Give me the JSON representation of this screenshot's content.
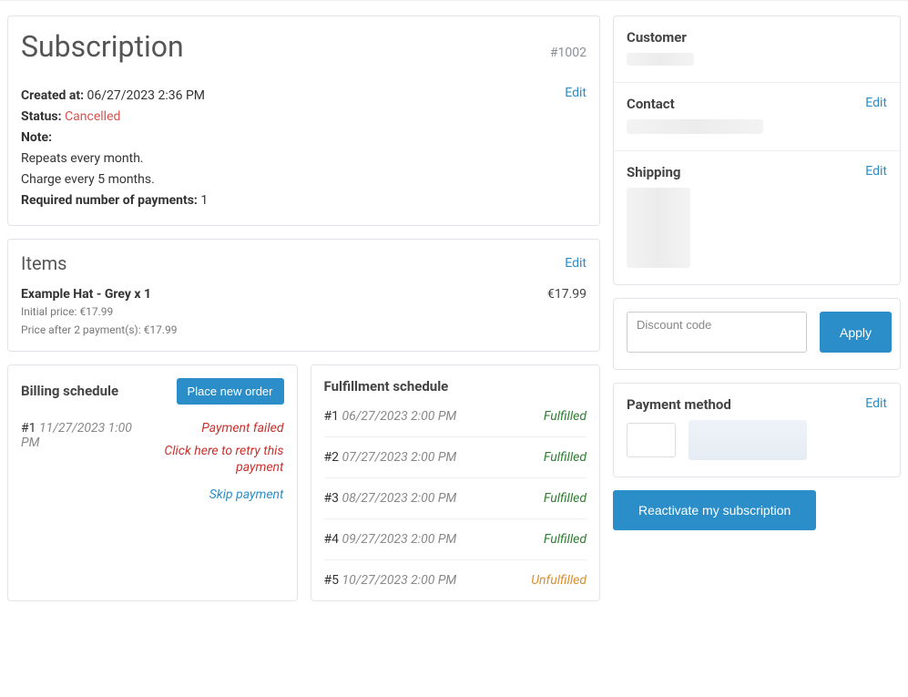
{
  "header": {
    "title": "Subscription",
    "order_number": "#1002",
    "created_label": "Created at:",
    "created_at": "06/27/2023 2:36 PM",
    "status_label": "Status:",
    "status_value": "Cancelled",
    "note_label": "Note:",
    "repeats": "Repeats every month.",
    "charge": "Charge every 5 months.",
    "req_label": "Required number of payments:",
    "req_value": "1",
    "edit": "Edit"
  },
  "items": {
    "title": "Items",
    "edit": "Edit",
    "item_name": "Example Hat - Grey x 1",
    "item_price": "€17.99",
    "initial_price": "Initial price: €17.99",
    "price_after": "Price after 2 payment(s): €17.99"
  },
  "billing": {
    "title": "Billing schedule",
    "place_order": "Place new order",
    "idx": "#1",
    "date": "11/27/2023 1:00 PM",
    "failed": "Payment failed",
    "retry": "Click here to retry this payment",
    "skip": "Skip payment"
  },
  "fulfillment": {
    "title": "Fulfillment schedule",
    "rows": [
      {
        "idx": "#1",
        "date": "06/27/2023 2:00 PM",
        "status": "Fulfilled",
        "cls": "fulfilled"
      },
      {
        "idx": "#2",
        "date": "07/27/2023 2:00 PM",
        "status": "Fulfilled",
        "cls": "fulfilled"
      },
      {
        "idx": "#3",
        "date": "08/27/2023 2:00 PM",
        "status": "Fulfilled",
        "cls": "fulfilled"
      },
      {
        "idx": "#4",
        "date": "09/27/2023 2:00 PM",
        "status": "Fulfilled",
        "cls": "fulfilled"
      },
      {
        "idx": "#5",
        "date": "10/27/2023 2:00 PM",
        "status": "Unfulfilled",
        "cls": "unfulfilled"
      }
    ]
  },
  "side": {
    "customer_title": "Customer",
    "contact_title": "Contact",
    "contact_edit": "Edit",
    "shipping_title": "Shipping",
    "shipping_edit": "Edit",
    "discount_placeholder": "Discount code",
    "apply": "Apply",
    "payment_title": "Payment method",
    "payment_edit": "Edit",
    "reactivate": "Reactivate my subscription"
  }
}
